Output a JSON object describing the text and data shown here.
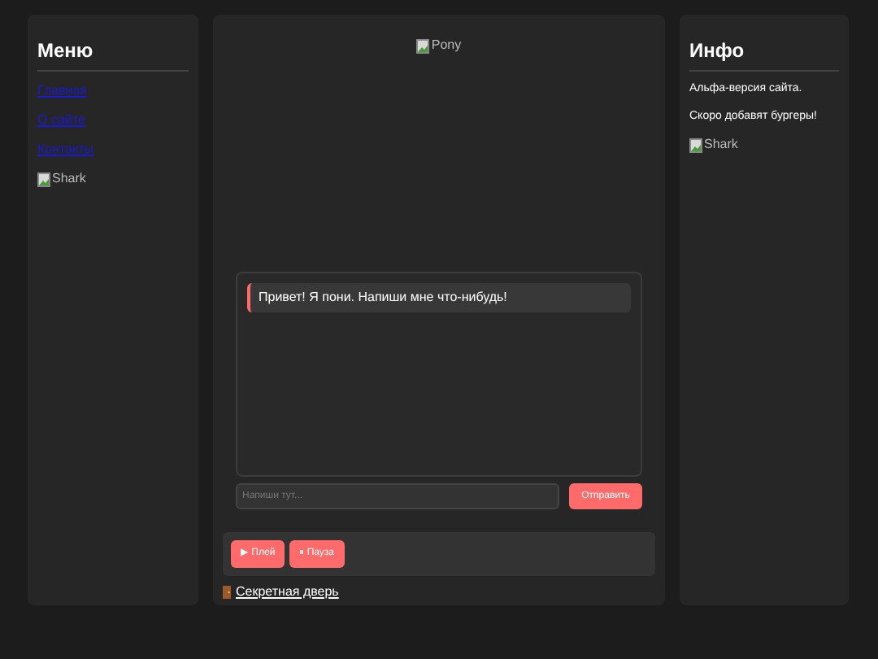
{
  "menu": {
    "title": "Меню",
    "links": [
      "Главная",
      "О сайте",
      "Контакты"
    ],
    "image_alt": "Shark"
  },
  "center": {
    "image_alt": "Pony",
    "chat": {
      "messages": [
        "Привет! Я пони. Напиши мне что-нибудь!"
      ],
      "input": {
        "placeholder": "Напиши тут..."
      },
      "send_button": "Отправить"
    },
    "player": {
      "buttons": [
        "▶ Плей",
        "⏸ Пауза"
      ]
    },
    "secret_link": "Секретная дверь"
  },
  "info": {
    "title": "Инфо",
    "paragraphs": [
      "Альфа-версия сайта.",
      "Скоро добавят бургеры!"
    ],
    "image_alt": "Shark"
  }
}
